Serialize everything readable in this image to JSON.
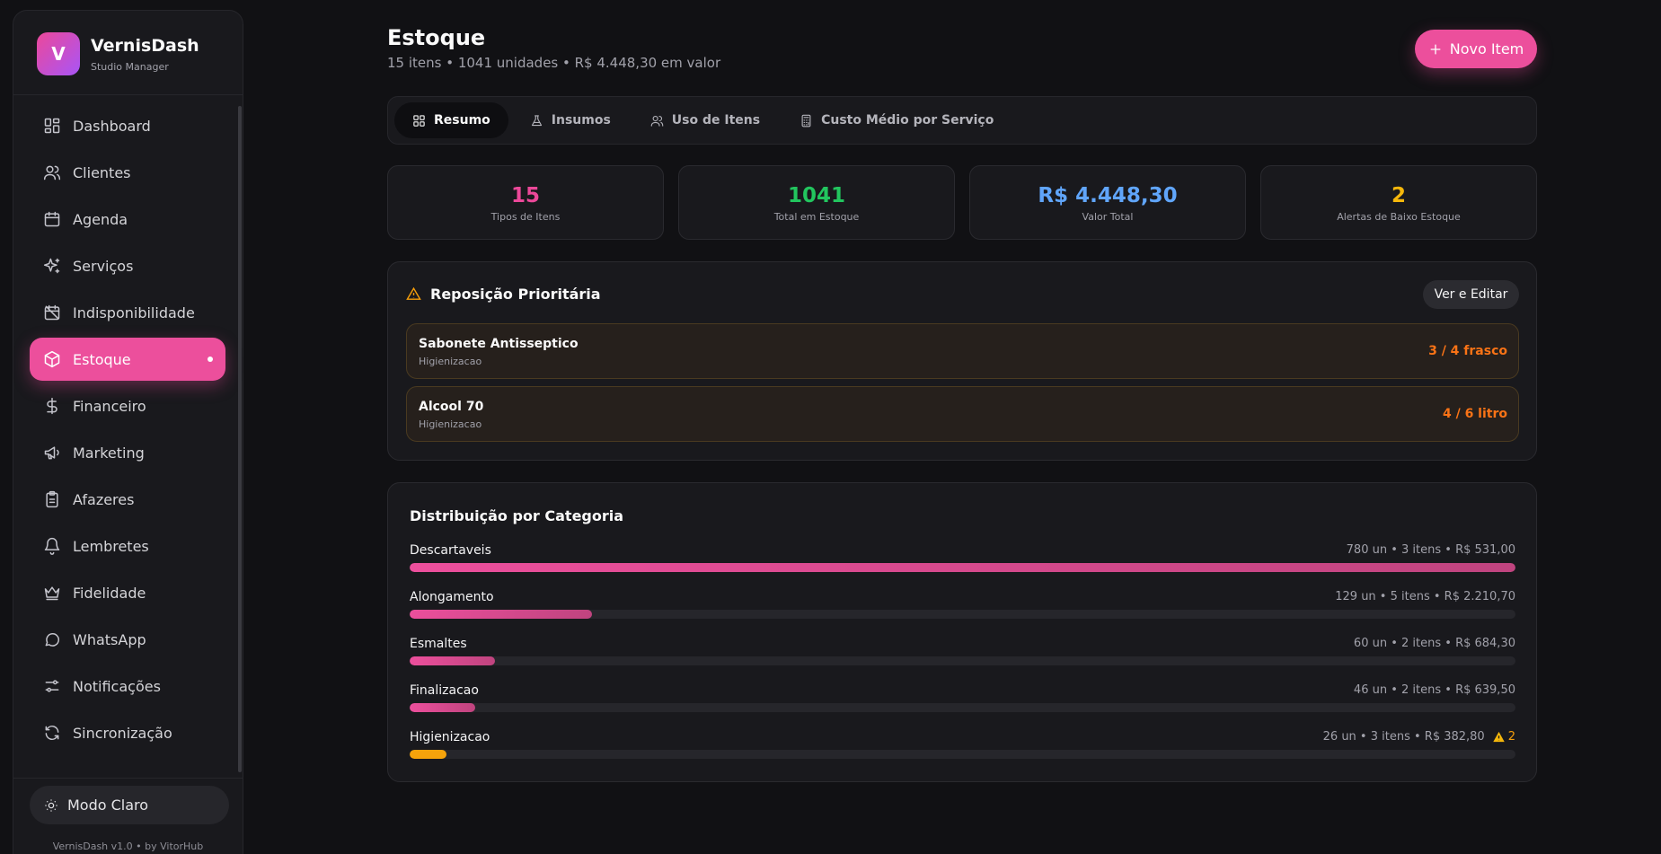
{
  "brand": {
    "initial": "V",
    "name": "VernisDash",
    "subtitle": "Studio Manager"
  },
  "nav": [
    {
      "label": "Dashboard",
      "icon": "dashboard-icon"
    },
    {
      "label": "Clientes",
      "icon": "users-icon"
    },
    {
      "label": "Agenda",
      "icon": "calendar-icon"
    },
    {
      "label": "Serviços",
      "icon": "sparkles-icon"
    },
    {
      "label": "Indisponibilidade",
      "icon": "calendar-off-icon"
    },
    {
      "label": "Estoque",
      "icon": "package-icon",
      "active": true
    },
    {
      "label": "Financeiro",
      "icon": "dollar-icon"
    },
    {
      "label": "Marketing",
      "icon": "megaphone-icon"
    },
    {
      "label": "Afazeres",
      "icon": "clipboard-icon"
    },
    {
      "label": "Lembretes",
      "icon": "bell-icon"
    },
    {
      "label": "Fidelidade",
      "icon": "crown-icon"
    },
    {
      "label": "WhatsApp",
      "icon": "chat-icon"
    },
    {
      "label": "Notificações",
      "icon": "sliders-icon"
    },
    {
      "label": "Sincronização",
      "icon": "refresh-icon"
    }
  ],
  "theme_toggle": {
    "label": "Modo Claro",
    "icon": "sun-icon"
  },
  "version": "VernisDash v1.0 • by VitorHub",
  "header": {
    "title": "Estoque",
    "subtitle": "15 itens • 1041 unidades • R$ 4.448,30 em valor",
    "new_button": "Novo Item"
  },
  "tabs": [
    {
      "label": "Resumo",
      "icon": "grid-icon",
      "active": true
    },
    {
      "label": "Insumos",
      "icon": "flask-icon"
    },
    {
      "label": "Uso de Itens",
      "icon": "users-icon"
    },
    {
      "label": "Custo Médio por Serviço",
      "icon": "calculator-icon"
    }
  ],
  "stats": [
    {
      "value": "15",
      "label": "Tipos de Itens",
      "color": "#ec4899"
    },
    {
      "value": "1041",
      "label": "Total em Estoque",
      "color": "#22c55e"
    },
    {
      "value": "R$ 4.448,30",
      "label": "Valor Total",
      "color": "#60a5fa"
    },
    {
      "value": "2",
      "label": "Alertas de Baixo Estoque",
      "color": "#f5b70b"
    }
  ],
  "priority": {
    "title": "Reposição Prioritária",
    "edit_button": "Ver e Editar",
    "items": [
      {
        "name": "Sabonete Antisseptico",
        "category": "Higienizacao",
        "qty": "3 / 4 frasco"
      },
      {
        "name": "Alcool 70",
        "category": "Higienizacao",
        "qty": "4 / 6 litro"
      }
    ]
  },
  "distribution": {
    "title": "Distribuição por Categoria",
    "categories": [
      {
        "name": "Descartaveis",
        "meta": "780 un • 3 itens • R$ 531,00",
        "fraction": 1.0
      },
      {
        "name": "Alongamento",
        "meta": "129 un • 5 itens • R$ 2.210,70",
        "fraction": 0.165
      },
      {
        "name": "Esmaltes",
        "meta": "60 un • 2 itens • R$ 684,30",
        "fraction": 0.077
      },
      {
        "name": "Finalizacao",
        "meta": "46 un • 2 itens • R$ 639,50",
        "fraction": 0.059
      },
      {
        "name": "Higienizacao",
        "meta": "26 un • 3 itens • R$ 382,80",
        "fraction": 0.033,
        "alerts": "2",
        "color": "#f5a30b"
      }
    ]
  }
}
